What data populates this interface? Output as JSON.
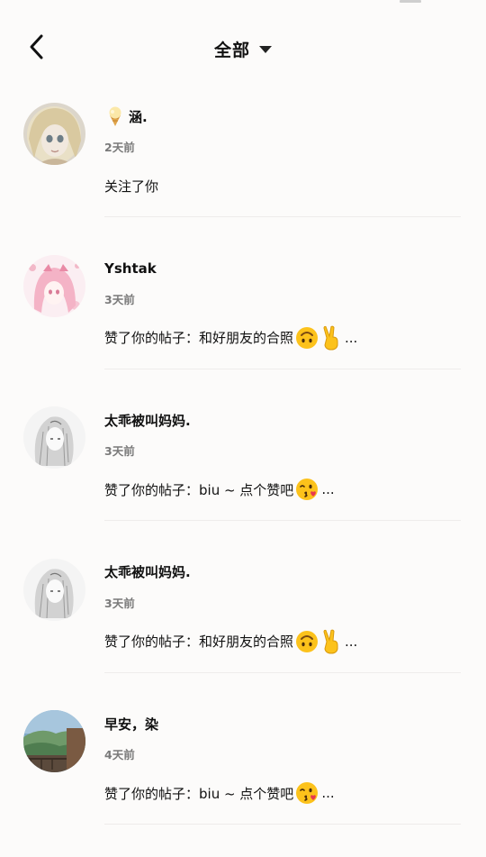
{
  "header": {
    "back_icon": "chevron-left-icon",
    "title": "全部",
    "filter_icon": "caret-down-icon"
  },
  "notifications": [
    {
      "name_emoji": "ice-cream-icon",
      "name": "涵.",
      "time": "2天前",
      "action": "关注了你",
      "emojis": [],
      "ellipsis": ""
    },
    {
      "name_emoji": "",
      "name": "Yshtak",
      "time": "3天前",
      "action": "赞了你的帖子：和好朋友的合照",
      "emojis": [
        "upside-down-face-icon",
        "victory-hand-icon"
      ],
      "ellipsis": "..."
    },
    {
      "name_emoji": "",
      "name": "太乖被叫妈妈.",
      "time": "3天前",
      "action": "赞了你的帖子：biu ~ 点个赞吧",
      "emojis": [
        "face-blowing-kiss-icon"
      ],
      "ellipsis": "..."
    },
    {
      "name_emoji": "",
      "name": "太乖被叫妈妈.",
      "time": "3天前",
      "action": "赞了你的帖子：和好朋友的合照",
      "emojis": [
        "upside-down-face-icon",
        "victory-hand-icon"
      ],
      "ellipsis": "..."
    },
    {
      "name_emoji": "",
      "name": "早安，染",
      "time": "4天前",
      "action": "赞了你的帖子：biu ~ 点个赞吧",
      "emojis": [
        "face-blowing-kiss-icon"
      ],
      "ellipsis": "..."
    }
  ]
}
